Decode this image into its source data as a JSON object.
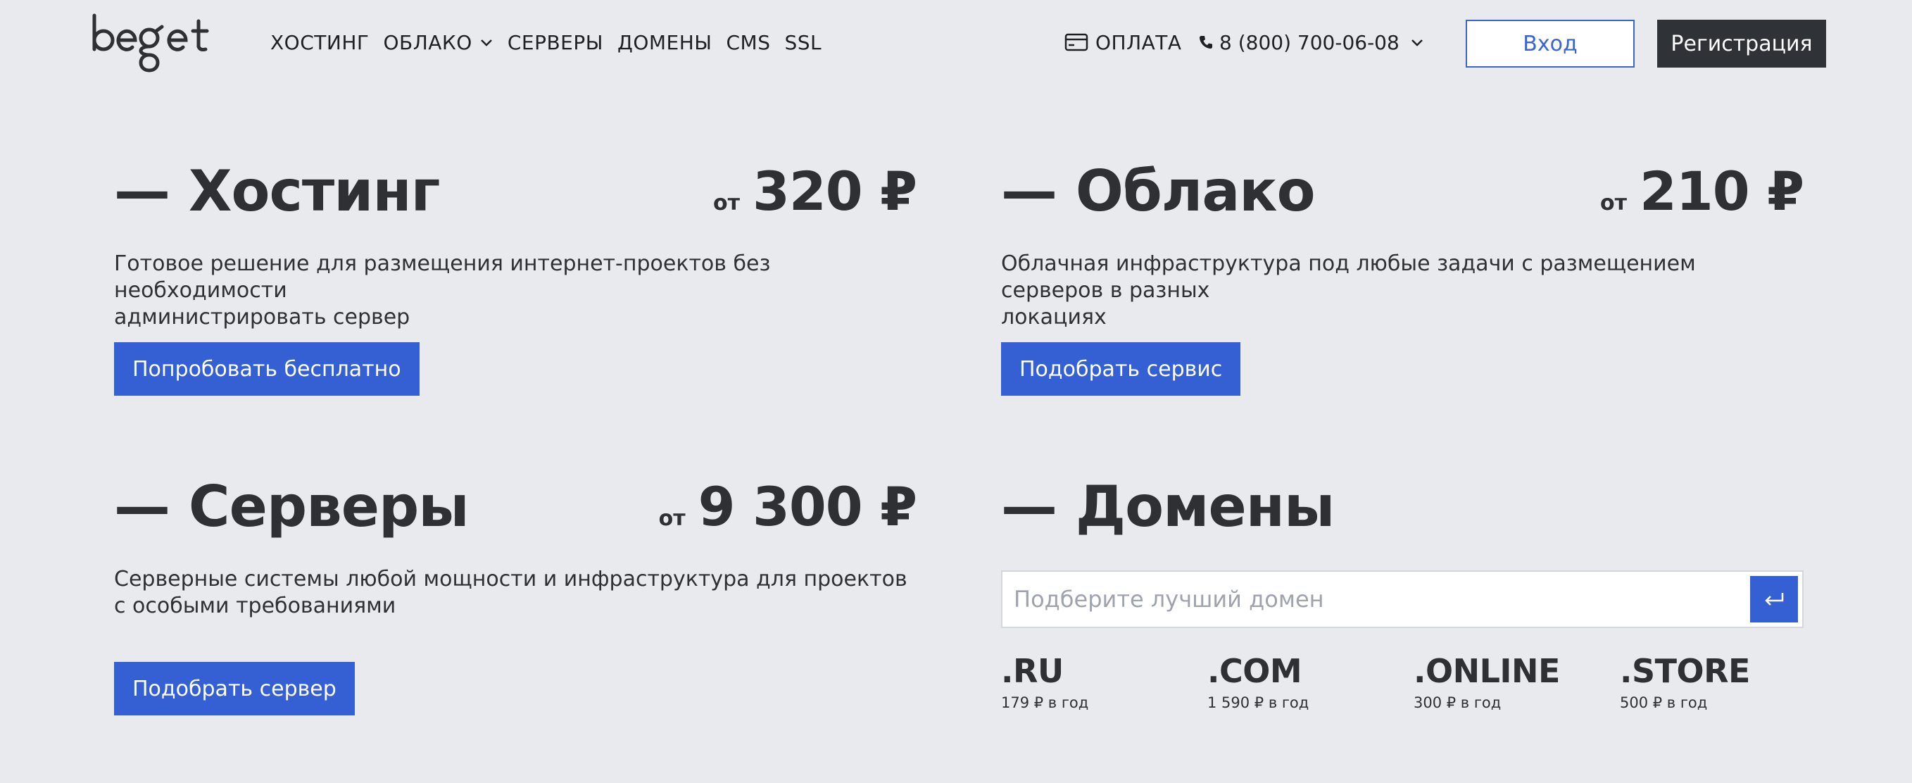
{
  "header": {
    "logo_text": "beget",
    "nav": [
      {
        "label": "ХОСТИНГ"
      },
      {
        "label": "ОБЛАКО"
      },
      {
        "label": "СЕРВЕРЫ"
      },
      {
        "label": "ДОМЕНЫ"
      },
      {
        "label": "CMS"
      },
      {
        "label": "SSL"
      }
    ],
    "payment_label": "ОПЛАТА",
    "phone": "8 (800) 700-06-08",
    "login_label": "Вход",
    "register_label": "Регистрация"
  },
  "products": {
    "hosting": {
      "title": "— Хостинг",
      "price_prefix": "от",
      "price": "320 ₽",
      "description_line1": "Готовое решение для размещения интернет-проектов без необходимости",
      "description_line2": "администрировать сервер",
      "button_label": "Попробовать бесплатно"
    },
    "cloud": {
      "title": "— Облако",
      "price_prefix": "от",
      "price": "210 ₽",
      "description_line1": "Облачная инфраструктура под любые задачи с размещением серверов в разных",
      "description_line2": "локациях",
      "button_label": "Подобрать сервис"
    },
    "servers": {
      "title": "— Серверы",
      "price_prefix": "от",
      "price": "9 300 ₽",
      "description_line1": "Серверные системы любой мощности и инфраструктура для проектов",
      "description_line2": "с особыми требованиями",
      "button_label": "Подобрать сервер"
    },
    "domains": {
      "title": "— Домены",
      "search_placeholder": "Подберите лучший домен",
      "zones": [
        {
          "tld": ".RU",
          "price": "179 ₽ в год"
        },
        {
          "tld": ".COM",
          "price": "1 590 ₽ в год"
        },
        {
          "tld": ".ONLINE",
          "price": "300 ₽ в год"
        },
        {
          "tld": ".STORE",
          "price": "500 ₽ в год"
        }
      ]
    }
  },
  "colors": {
    "background": "#e9eaee",
    "accent_blue": "#3560d3",
    "dark_button": "#2f3236",
    "text": "#2f3033"
  },
  "icons": {
    "payment": "card-icon",
    "phone": "phone-icon",
    "dropdown": "chevron-down-icon",
    "search_submit": "enter-arrow-icon"
  }
}
